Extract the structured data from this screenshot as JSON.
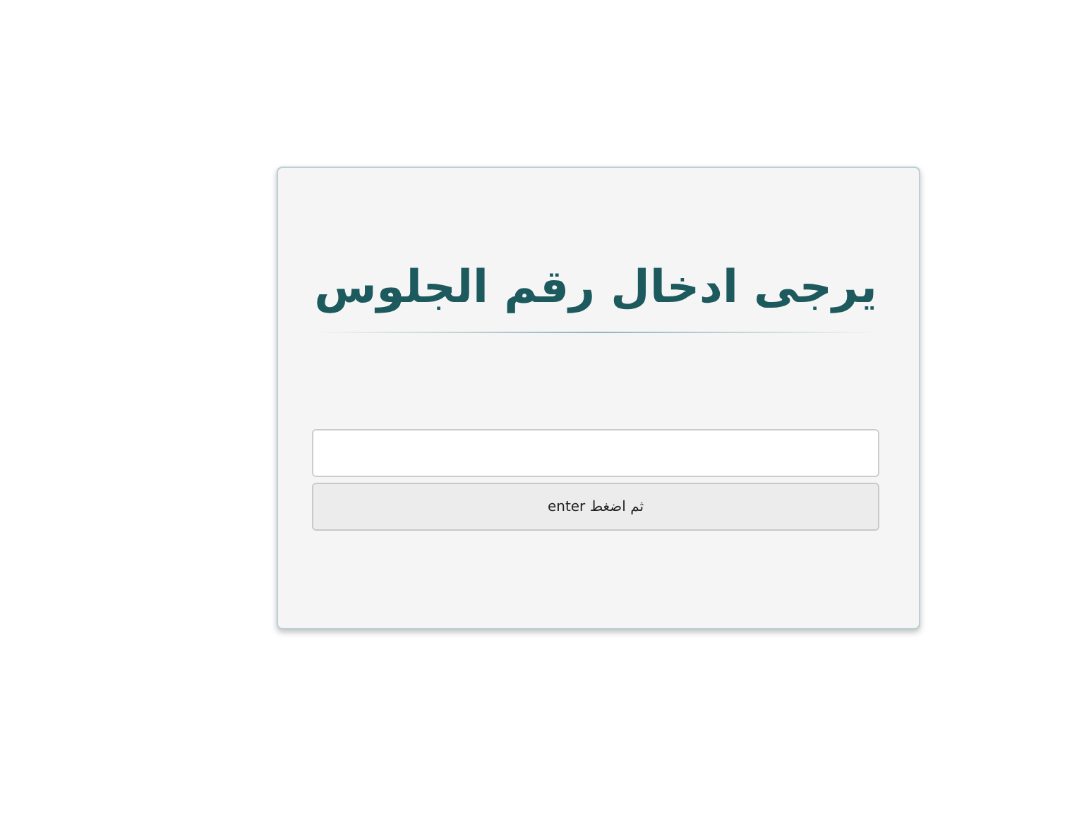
{
  "card": {
    "title": "يرجى ادخال رقم الجلوس",
    "button": {
      "label": "ثم اضغط enter"
    }
  }
}
